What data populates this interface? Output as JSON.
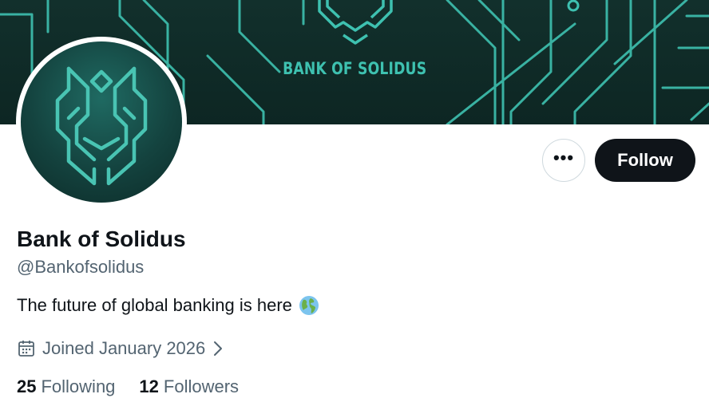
{
  "banner": {
    "brand_text": "BANK OF SOLIDUS",
    "accent_color": "#3ec1b0",
    "background_color": "#12302c"
  },
  "profile": {
    "display_name": "Bank of Solidus",
    "handle": "@Bankofsolidus",
    "bio": "The future of global banking is here",
    "bio_emoji": "globe-icon",
    "joined": "Joined January 2026",
    "following_count": "25",
    "following_label": "Following",
    "followers_count": "12",
    "followers_label": "Followers"
  },
  "actions": {
    "more_icon": "more-dots-icon",
    "follow_label": "Follow"
  }
}
